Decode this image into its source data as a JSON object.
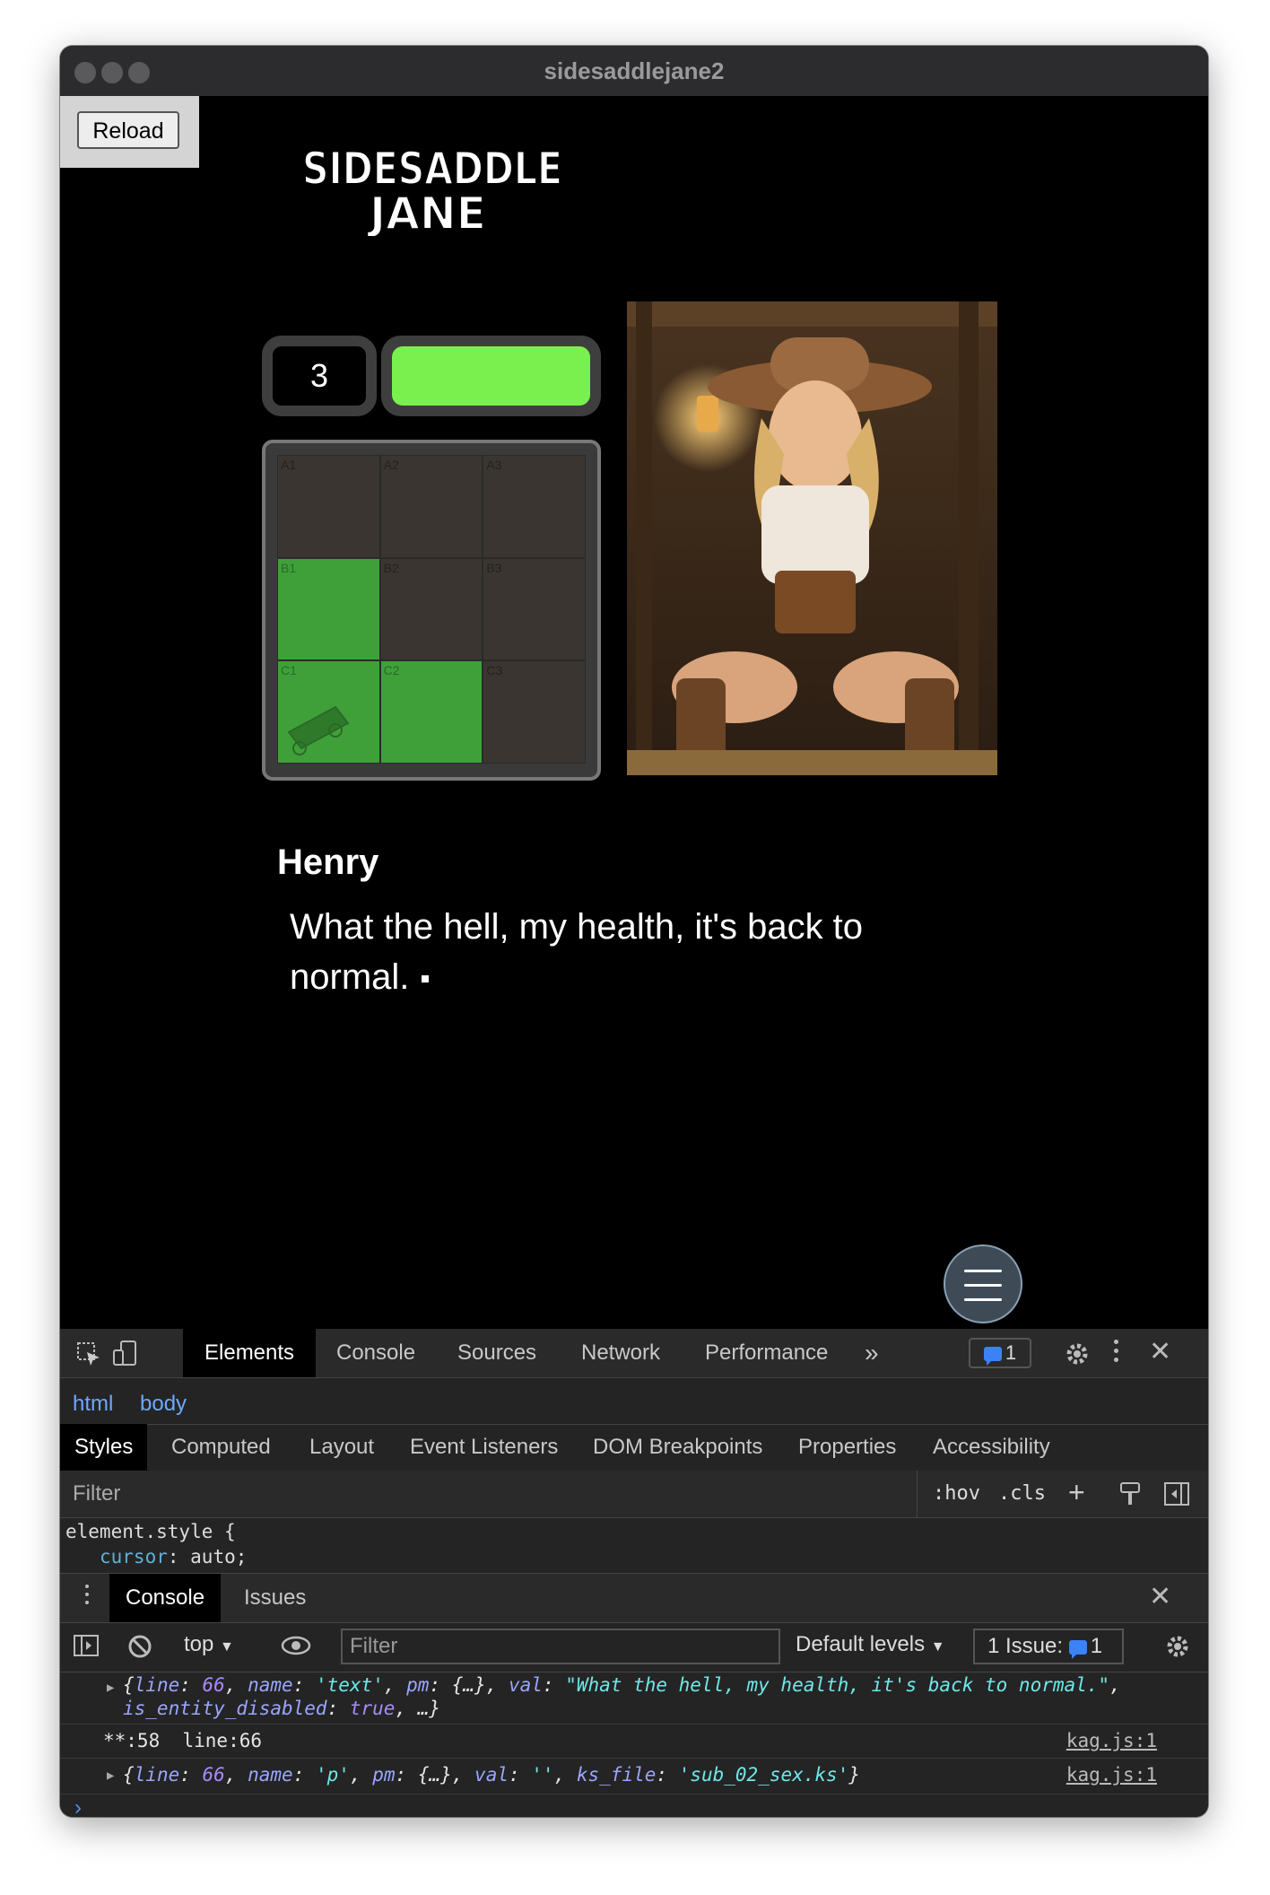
{
  "window": {
    "title": "sidesaddlejane2"
  },
  "game": {
    "reload_label": "Reload",
    "logo_line1": "SIDESADDLE",
    "logo_line2": "JANE",
    "turn_counter": "3",
    "health_percent": 100,
    "grid_cells": [
      {
        "label": "A1",
        "visited": false
      },
      {
        "label": "A2",
        "visited": false
      },
      {
        "label": "A3",
        "visited": false
      },
      {
        "label": "B1",
        "visited": true
      },
      {
        "label": "B2",
        "visited": false
      },
      {
        "label": "B3",
        "visited": false
      },
      {
        "label": "C1",
        "visited": true
      },
      {
        "label": "C2",
        "visited": true
      },
      {
        "label": "C3",
        "visited": false
      }
    ],
    "speaker": "Henry",
    "dialogue": "What the hell, my health, it's back to normal."
  },
  "devtools": {
    "tabs": [
      "Elements",
      "Console",
      "Sources",
      "Network",
      "Performance"
    ],
    "active_tab": "Elements",
    "issue_count": "1",
    "breadcrumb": [
      "html",
      "body"
    ],
    "style_tabs": [
      "Styles",
      "Computed",
      "Layout",
      "Event Listeners",
      "DOM Breakpoints",
      "Properties",
      "Accessibility"
    ],
    "filter_placeholder": "Filter",
    "hov": ":hov",
    "cls": ".cls",
    "element_style_selector": "element.style {",
    "element_style_prop": "cursor",
    "element_style_value": "auto;",
    "drawer_tabs": [
      "Console",
      "Issues"
    ],
    "console_context": "top",
    "console_filter_placeholder": "Filter",
    "default_levels": "Default levels",
    "issues_label": "1 Issue:",
    "issues_count": "1",
    "log": {
      "row1_line": "66",
      "row1_name": "'text'",
      "row1_val": "\"What the hell, my health, it's back to normal.\"",
      "row1_extra_key": "is_entity_disabled",
      "row1_extra_val": "true",
      "row2_text": "**:58  line:66",
      "row2_source": "kag.js:1",
      "row3_line": "66",
      "row3_name": "'p'",
      "row3_val": "''",
      "row3_file": "'sub_02_sex.ks'",
      "row3_source": "kag.js:1"
    }
  }
}
